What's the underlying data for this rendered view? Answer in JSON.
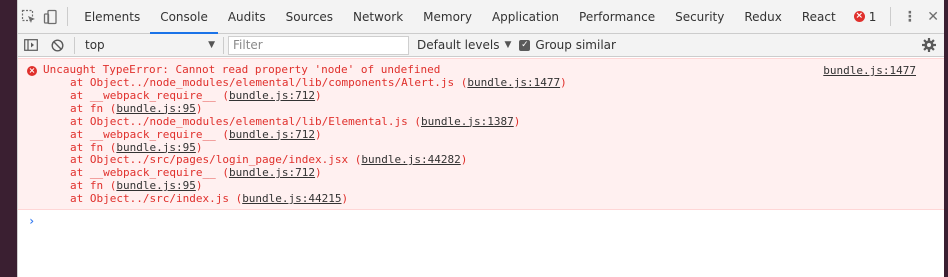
{
  "tabs": {
    "items": [
      {
        "label": "Elements",
        "selected": false
      },
      {
        "label": "Console",
        "selected": true
      },
      {
        "label": "Audits",
        "selected": false
      },
      {
        "label": "Sources",
        "selected": false
      },
      {
        "label": "Network",
        "selected": false
      },
      {
        "label": "Memory",
        "selected": false
      },
      {
        "label": "Application",
        "selected": false
      },
      {
        "label": "Performance",
        "selected": false
      },
      {
        "label": "Security",
        "selected": false
      },
      {
        "label": "Redux",
        "selected": false
      },
      {
        "label": "React",
        "selected": false
      }
    ],
    "error_count": "1"
  },
  "toolbar": {
    "context": "top",
    "filter_placeholder": "Filter",
    "levels_label": "Default levels",
    "group_similar_label": "Group similar",
    "group_similar_checked": true
  },
  "console": {
    "error": {
      "message": "Uncaught TypeError: Cannot read property 'node' of undefined",
      "source": "bundle.js:1477",
      "stack": [
        {
          "prefix": "at Object../node_modules/elemental/lib/components/Alert.js (",
          "loc": "bundle.js:1477",
          "suffix": ")"
        },
        {
          "prefix": "at __webpack_require__ (",
          "loc": "bundle.js:712",
          "suffix": ")"
        },
        {
          "prefix": "at fn (",
          "loc": "bundle.js:95",
          "suffix": ")"
        },
        {
          "prefix": "at Object../node_modules/elemental/lib/Elemental.js (",
          "loc": "bundle.js:1387",
          "suffix": ")"
        },
        {
          "prefix": "at __webpack_require__ (",
          "loc": "bundle.js:712",
          "suffix": ")"
        },
        {
          "prefix": "at fn (",
          "loc": "bundle.js:95",
          "suffix": ")"
        },
        {
          "prefix": "at Object../src/pages/login_page/index.jsx (",
          "loc": "bundle.js:44282",
          "suffix": ")"
        },
        {
          "prefix": "at __webpack_require__ (",
          "loc": "bundle.js:712",
          "suffix": ")"
        },
        {
          "prefix": "at fn (",
          "loc": "bundle.js:95",
          "suffix": ")"
        },
        {
          "prefix": "at Object../src/index.js (",
          "loc": "bundle.js:44215",
          "suffix": ")"
        }
      ]
    },
    "prompt_symbol": "›"
  },
  "icons": {
    "inspect": "inspect-element-icon",
    "device": "device-toolbar-icon",
    "sidebar": "show-sidebar-icon",
    "clear": "clear-console-icon",
    "settings": "gear-icon",
    "more": "kebab-menu-icon",
    "close": "close-icon"
  },
  "colors": {
    "accent": "#1a73e8",
    "error_text": "#e0302c",
    "error_bg": "#fff0f0",
    "prompt": "#367cf1"
  }
}
